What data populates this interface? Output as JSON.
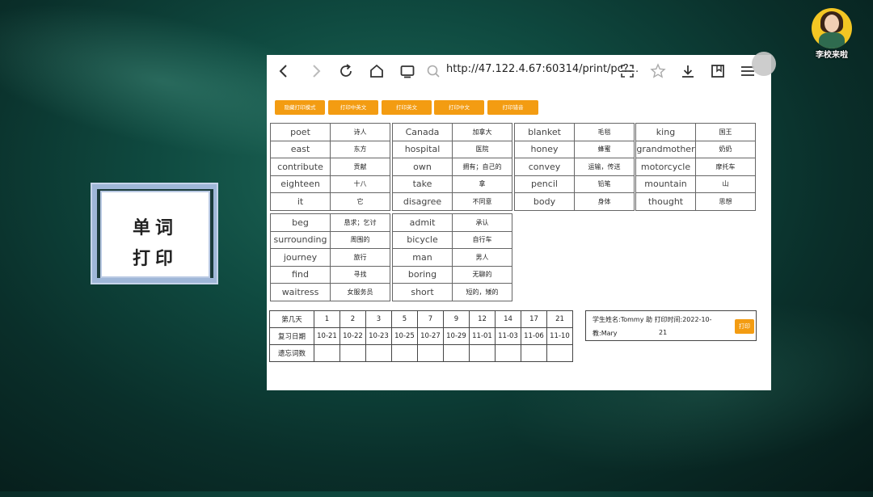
{
  "title_card": {
    "line1": "单词",
    "line2": "打印"
  },
  "logo": {
    "text": "李校来啦"
  },
  "browser": {
    "url": "http://47.122.4.67:60314/print/pc?...",
    "icons": [
      "back-icon",
      "forward-icon",
      "reload-icon",
      "home-icon",
      "tabs-icon",
      "search-icon",
      "scan-icon",
      "star-icon",
      "download-icon",
      "bookmarks-icon",
      "menu-icon"
    ]
  },
  "buttons": [
    "隐藏打印模式",
    "打印中英文",
    "打印英文",
    "打印中文",
    "打印错音"
  ],
  "word_blocks": [
    {
      "rows": [
        [
          "poet",
          "诗人"
        ],
        [
          "east",
          "东方"
        ],
        [
          "contribute",
          "贡献"
        ],
        [
          "eighteen",
          "十八"
        ],
        [
          "it",
          "它"
        ]
      ]
    },
    {
      "rows": [
        [
          "Canada",
          "加拿大"
        ],
        [
          "hospital",
          "医院"
        ],
        [
          "own",
          "拥有；自己的"
        ],
        [
          "take",
          "拿"
        ],
        [
          "disagree",
          "不同意"
        ]
      ]
    },
    {
      "rows": [
        [
          "blanket",
          "毛毯"
        ],
        [
          "honey",
          "蜂蜜"
        ],
        [
          "convey",
          "运输，传送"
        ],
        [
          "pencil",
          "铅笔"
        ],
        [
          "body",
          "身体"
        ]
      ]
    },
    {
      "rows": [
        [
          "king",
          "国王"
        ],
        [
          "grandmother",
          "奶奶"
        ],
        [
          "motorcycle",
          "摩托车"
        ],
        [
          "mountain",
          "山"
        ],
        [
          "thought",
          "思想"
        ]
      ]
    },
    {
      "rows": [
        [
          "beg",
          "恳求；乞讨"
        ],
        [
          "surrounding",
          "周围的"
        ],
        [
          "journey",
          "旅行"
        ],
        [
          "find",
          "寻找"
        ],
        [
          "waitress",
          "女服务员"
        ]
      ]
    },
    {
      "rows": [
        [
          "admit",
          "承认"
        ],
        [
          "bicycle",
          "自行车"
        ],
        [
          "man",
          "男人"
        ],
        [
          "boring",
          "无聊的"
        ],
        [
          "short",
          "短的，矮的"
        ]
      ]
    }
  ],
  "review": {
    "day_label": "第几天",
    "days": [
      "1",
      "2",
      "3",
      "5",
      "7",
      "9",
      "12",
      "14",
      "17",
      "21"
    ],
    "date_label": "复习日期",
    "dates": [
      "10-21",
      "10-22",
      "10-23",
      "10-25",
      "10-27",
      "10-29",
      "11-01",
      "11-03",
      "11-06",
      "11-10"
    ],
    "forget_label": "遗忘词数"
  },
  "info": {
    "line1": "学生姓名:Tommy 助 打印时间:2022-10-",
    "line2": "教:Mary",
    "line3": "21",
    "print_button": "打印"
  }
}
